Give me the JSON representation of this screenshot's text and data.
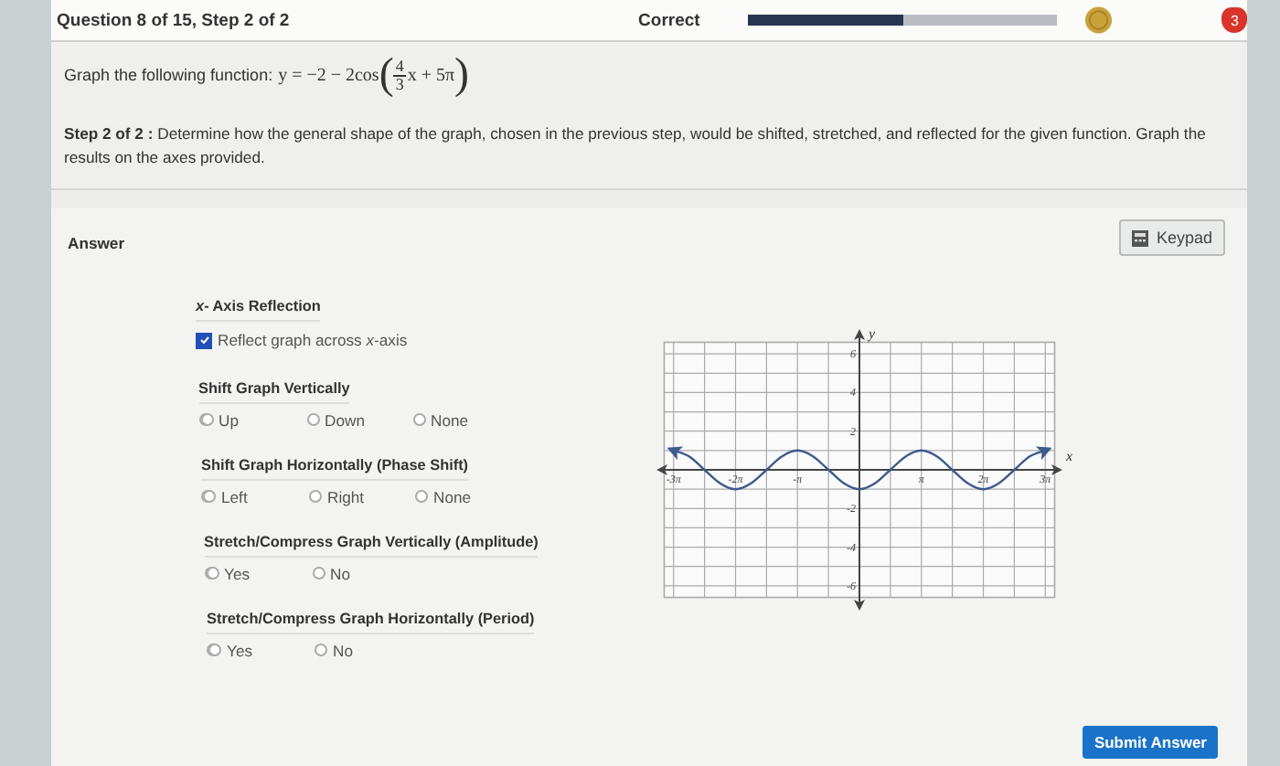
{
  "header": {
    "title": "Question 8 of 15, Step 2 of 2",
    "status": "Correct",
    "progress": {
      "level": 0.5
    },
    "badge": "3"
  },
  "question": {
    "prompt": "Graph the following function:",
    "equation": {
      "before": "y = −2 − 2cos",
      "open": "(",
      "numerator": "4",
      "denominator": "3",
      "after": "x + 5π",
      "close": ")"
    },
    "step": "**Step 2 of 2 :** Determine how the general shape of the graph, chosen in the previous step, would be shifted, stretched, and reflected for the given function. Graph the results on the axes provided."
  },
  "answer": {
    "label": "Answer",
    "keypad": "Keypad",
    "sections": [
      {
        "kind": "checkbox",
        "title": "*x*- Axis Reflection",
        "options": [
          {
            "label": "Reflect graph across *x*-axis",
            "checked": true
          }
        ]
      },
      {
        "kind": "radio",
        "title": "Shift Graph Vertically",
        "options": [
          {
            "label": "Up",
            "selected": false
          },
          {
            "label": "Down",
            "selected": false
          },
          {
            "label": "None",
            "selected": false
          }
        ]
      },
      {
        "kind": "radio",
        "title": "Shift Graph Horizontally (Phase Shift)",
        "options": [
          {
            "label": "Left",
            "selected": false
          },
          {
            "label": "Right",
            "selected": false
          },
          {
            "label": "None",
            "selected": false
          }
        ]
      },
      {
        "kind": "radio",
        "title": "Stretch/Compress Graph Vertically (Amplitude)",
        "options": [
          {
            "label": "Yes",
            "selected": false
          },
          {
            "label": "No",
            "selected": false
          }
        ]
      },
      {
        "kind": "radio",
        "title": "Stretch/Compress Graph Horizontally (Period)",
        "options": [
          {
            "label": "Yes",
            "selected": false
          },
          {
            "label": "No",
            "selected": false
          }
        ]
      }
    ],
    "chart_data": {
      "type": "line",
      "xlabel": "x",
      "ylabel": "y",
      "x": [
        -9.425,
        -8.639,
        -7.854,
        -7.069,
        -6.283,
        -5.498,
        -4.712,
        -3.927,
        -3.142,
        -2.356,
        -1.571,
        -0.785,
        0,
        0.785,
        1.571,
        2.356,
        3.142,
        3.927,
        4.712,
        5.498,
        6.283,
        7.069,
        7.854,
        8.639,
        9.425
      ],
      "series": [
        {
          "color": "#3d5a8c",
          "values": [
            1,
            0.7,
            0,
            -0.7,
            -1,
            -0.7,
            0,
            0.7,
            1,
            0.7,
            0,
            -0.7,
            -1,
            -0.7,
            0,
            0.7,
            1,
            0.7,
            0,
            -0.7,
            -1,
            -0.7,
            0,
            0.7,
            1
          ]
        }
      ],
      "xlim": [
        -10.2,
        10.2
      ],
      "ylim": [
        -7,
        7
      ],
      "grid": true,
      "xticks": [
        {
          "value": -9.425,
          "label": "-3π"
        },
        {
          "value": -6.283,
          "label": "-2π"
        },
        {
          "value": -3.142,
          "label": "-π"
        },
        {
          "value": 3.142,
          "label": "π"
        },
        {
          "value": 6.283,
          "label": "2π"
        },
        {
          "value": 9.425,
          "label": "3π"
        }
      ],
      "yticks": [
        6,
        4,
        2,
        -2,
        -4,
        -6
      ]
    }
  },
  "submit": "Submit Answer"
}
